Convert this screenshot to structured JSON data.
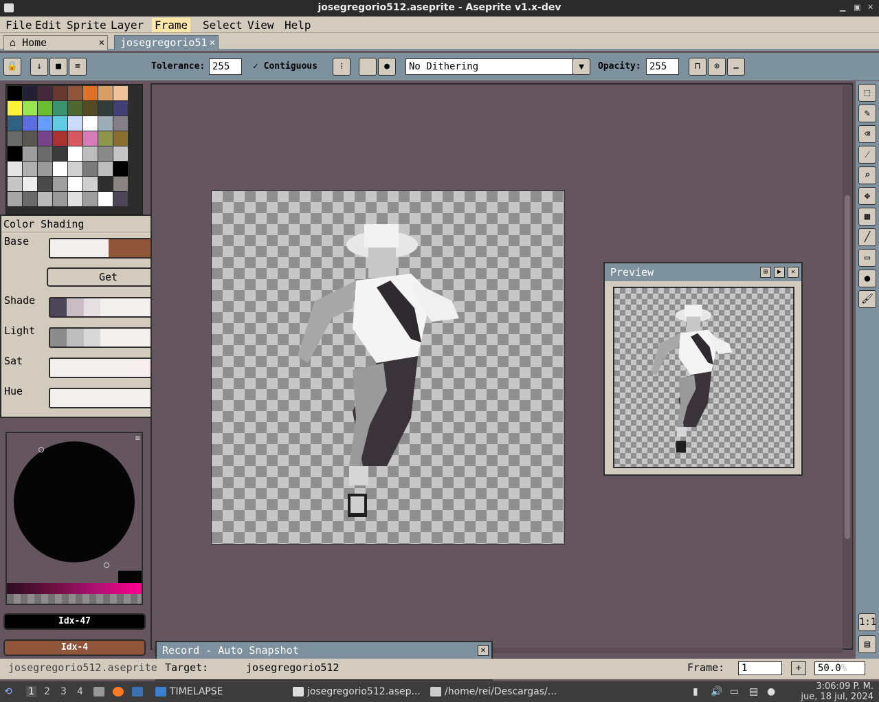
{
  "window": {
    "title": "josegregorio512.aseprite - Aseprite v1.x-dev"
  },
  "menu": [
    "File",
    "Edit",
    "Sprite",
    "Layer",
    "Frame",
    "Select",
    "View",
    "Help"
  ],
  "menu_active": "Frame",
  "tabs": {
    "home": "Home",
    "doc": "josegregorio51"
  },
  "context_bar": {
    "tolerance_label": "Tolerance:",
    "tolerance_value": "255",
    "contiguous_label": "Contiguous",
    "dithering": "No Dithering",
    "opacity_label": "Opacity:",
    "opacity_value": "255"
  },
  "palette_colors": [
    "#000000",
    "#222034",
    "#45283c",
    "#663931",
    "#8f563b",
    "#df7126",
    "#d9a066",
    "#eec39a",
    "#fbf236",
    "#99e550",
    "#6abe30",
    "#37946e",
    "#4b692f",
    "#524b24",
    "#323c39",
    "#3f3f74",
    "#306082",
    "#5b6ee1",
    "#639bff",
    "#5fcde4",
    "#cbdbfc",
    "#ffffff",
    "#9badb7",
    "#847e87",
    "#696a6a",
    "#595652",
    "#76428a",
    "#ac3232",
    "#d95763",
    "#d77bba",
    "#8f974a",
    "#8a6f30",
    "#000000",
    "#9e9e9e",
    "#6b6b6b",
    "#3a3a3a",
    "#ffffff",
    "#bdbdbd",
    "#8a8a8a",
    "#c6c6c6",
    "#e5e5e5",
    "#b0b0b0",
    "#9a9a9a",
    "#ffffff",
    "#d0d0d0",
    "#7a7a7a",
    "#bdbdbd",
    "#000000",
    "#c6c6c6",
    "#ededed",
    "#4a4a4a",
    "#a0a0a0",
    "#ffffff",
    "#cfcfcf",
    "#2e2e2e",
    "#8a8383",
    "#a6a6a6",
    "#6a6a6a",
    "#bbbbbb",
    "#9a9a9a",
    "#e0e0e0",
    "#9e9e9e",
    "#ffffff",
    "#4c4658"
  ],
  "color_shading": {
    "title": "Color Shading",
    "base_label": "Base",
    "get_label": "Get",
    "shade_label": "Shade",
    "light_label": "Light",
    "sat_label": "Sat",
    "hue_label": "Hue",
    "base_colors": [
      "#f2efee",
      "#8f563b"
    ],
    "shade_colors": [
      "#4c4658",
      "#c9bdc3",
      "#e6dfe2",
      "#f2efee",
      "#f2efee",
      "#f2efee",
      "#f2efee"
    ],
    "light_colors": [
      "#8c8c8c",
      "#bdbdbd",
      "#d8d8d8",
      "#f2efee",
      "#f2efee",
      "#f2efee",
      "#f2efee"
    ],
    "sat_colors": [
      "#f2efee",
      "#f2efee",
      "#f2efee",
      "#f2efee",
      "#f6edee",
      "#f9ebee"
    ],
    "hue_colors": [
      "#f2efee"
    ]
  },
  "colors": {
    "fg_label": "Idx-47",
    "fg_color": "#000000",
    "bg_label": "Idx-4",
    "bg_color": "#8f563b"
  },
  "preview": {
    "title": "Preview"
  },
  "record": {
    "title": "Record - Auto Snapshot",
    "target_label": "Target:",
    "target_value": "josegregorio512"
  },
  "status": {
    "filename": "josegregorio512.aseprite",
    "frame_label": "Frame:",
    "frame_value": "1",
    "zoom": "50.0"
  },
  "taskbar": {
    "workspaces": [
      "1",
      "2",
      "3",
      "4"
    ],
    "tasks": [
      "TIMELAPSE",
      "josegregorio512.asep...",
      "/home/rei/Descargas/..."
    ],
    "time": "3:06:09 P. M.",
    "date": "jue, 18 jul, 2024"
  }
}
